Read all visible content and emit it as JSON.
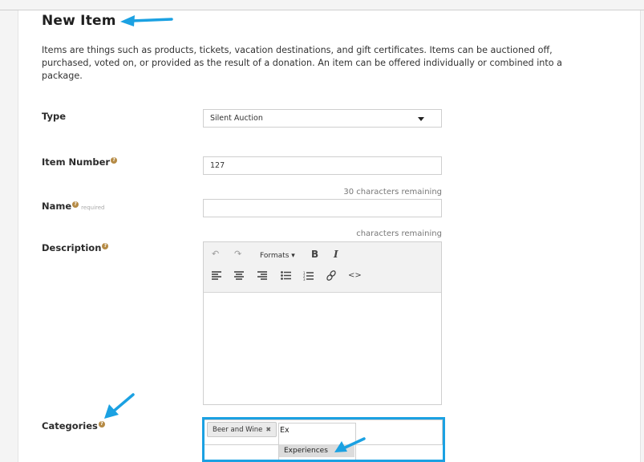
{
  "page": {
    "title": "New Item",
    "intro": "Items are things such as products, tickets, vacation destinations, and gift certificates. Items can be auctioned off, purchased, voted on, or provided as the result of a donation. An item can be offered individually or combined into a package."
  },
  "form": {
    "type": {
      "label": "Type",
      "value": "Silent Auction"
    },
    "item_number": {
      "label": "Item Number",
      "value": "127"
    },
    "name": {
      "label": "Name",
      "required_label": "required",
      "counter": "30 characters remaining",
      "value": ""
    },
    "description": {
      "label": "Description",
      "counter": "characters remaining",
      "toolbar": {
        "undo_icon": "undo-icon",
        "redo_icon": "redo-icon",
        "formats_label": "Formats ▾",
        "bold_label": "B",
        "italic_label": "I"
      }
    },
    "categories": {
      "label": "Categories",
      "selected_tags": [
        "Beer and Wine"
      ],
      "tag_remove_glyph": "✖",
      "typed_value": "Ex",
      "suggestion": "Experiences"
    }
  },
  "colors": {
    "highlight": "#1ba1e2",
    "help_badge": "#b58a44"
  }
}
